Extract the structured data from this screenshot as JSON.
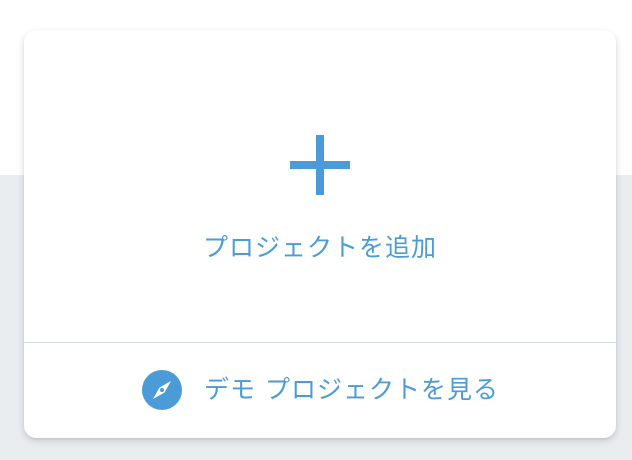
{
  "add_project": {
    "icon": "plus-icon",
    "label": "プロジェクトを追加"
  },
  "demo_project": {
    "icon": "compass-icon",
    "label": "デモ プロジェクトを見る"
  },
  "colors": {
    "accent": "#4a9bd8",
    "divider": "#d5dade",
    "background_band": "#e9edf0",
    "card": "#ffffff"
  }
}
